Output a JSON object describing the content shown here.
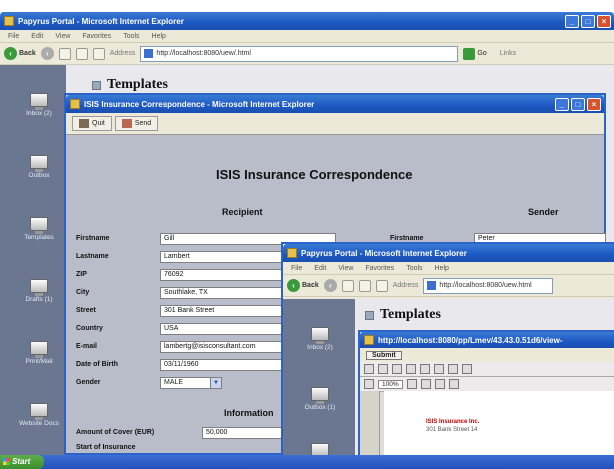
{
  "main_window": {
    "title": "Papyrus Portal - Microsoft Internet Explorer",
    "menu": [
      "File",
      "Edit",
      "View",
      "Favorites",
      "Tools",
      "Help"
    ],
    "back_label": "Back",
    "address_label": "Address",
    "address_url": "http://localhost:8080/uew/.html",
    "go_label": "Go",
    "links_label": "Links"
  },
  "portal": {
    "templates_title": "Templates",
    "nav_items": [
      "Inbox (2)",
      "Outbox",
      "Templates",
      "Drafts (1)",
      "Print/Mail",
      "Website Docs"
    ]
  },
  "isis_window": {
    "title": "ISIS Insurance Correspondence - Microsoft Internet Explorer",
    "toolbar": {
      "quit_label": "Quit",
      "send_label": "Send"
    },
    "heading": "ISIS Insurance Correspondence",
    "recipient_heading": "Recipient",
    "sender_heading": "Sender",
    "info_heading": "Information",
    "recipient_fields": [
      {
        "label": "Firstname",
        "value": "Gill"
      },
      {
        "label": "Lastname",
        "value": "Lambert"
      },
      {
        "label": "ZIP",
        "value": "76092"
      },
      {
        "label": "City",
        "value": "Southlake, TX"
      },
      {
        "label": "Street",
        "value": "301 Bank Street"
      },
      {
        "label": "Country",
        "value": "USA"
      },
      {
        "label": "E-mail",
        "value": "lambertg@isisconsultant.com"
      },
      {
        "label": "Date of Birth",
        "value": "03/11/1960"
      }
    ],
    "gender_label": "Gender",
    "gender_value": "MALE",
    "sender_firstname_label": "Firstname",
    "sender_firstname_value": "Peter",
    "amount_label": "Amount of Cover (EUR)",
    "amount_value": "50,000",
    "start_label": "Start of Insurance"
  },
  "third_window": {
    "title": "Papyrus Portal - Microsoft Internet Explorer",
    "menu": [
      "File",
      "Edit",
      "View",
      "Favorites",
      "Tools",
      "Help"
    ],
    "back_label": "Back",
    "address_label": "Address",
    "address_url": "http://localhost:8080/uew.html",
    "templates_title": "Templates",
    "nav_items": [
      "Inbox (2)",
      "Outbox (1)"
    ],
    "inner_title": "http://localhost:8080/pp/Lmev/43.43.0.51d6/view-",
    "submit_label": "Submit",
    "zoom_label": "100%",
    "doc_lines": [
      "ISIS Insurance Inc.",
      "301 Bank Street 14"
    ]
  },
  "taskbar": {
    "start_label": "Start"
  }
}
